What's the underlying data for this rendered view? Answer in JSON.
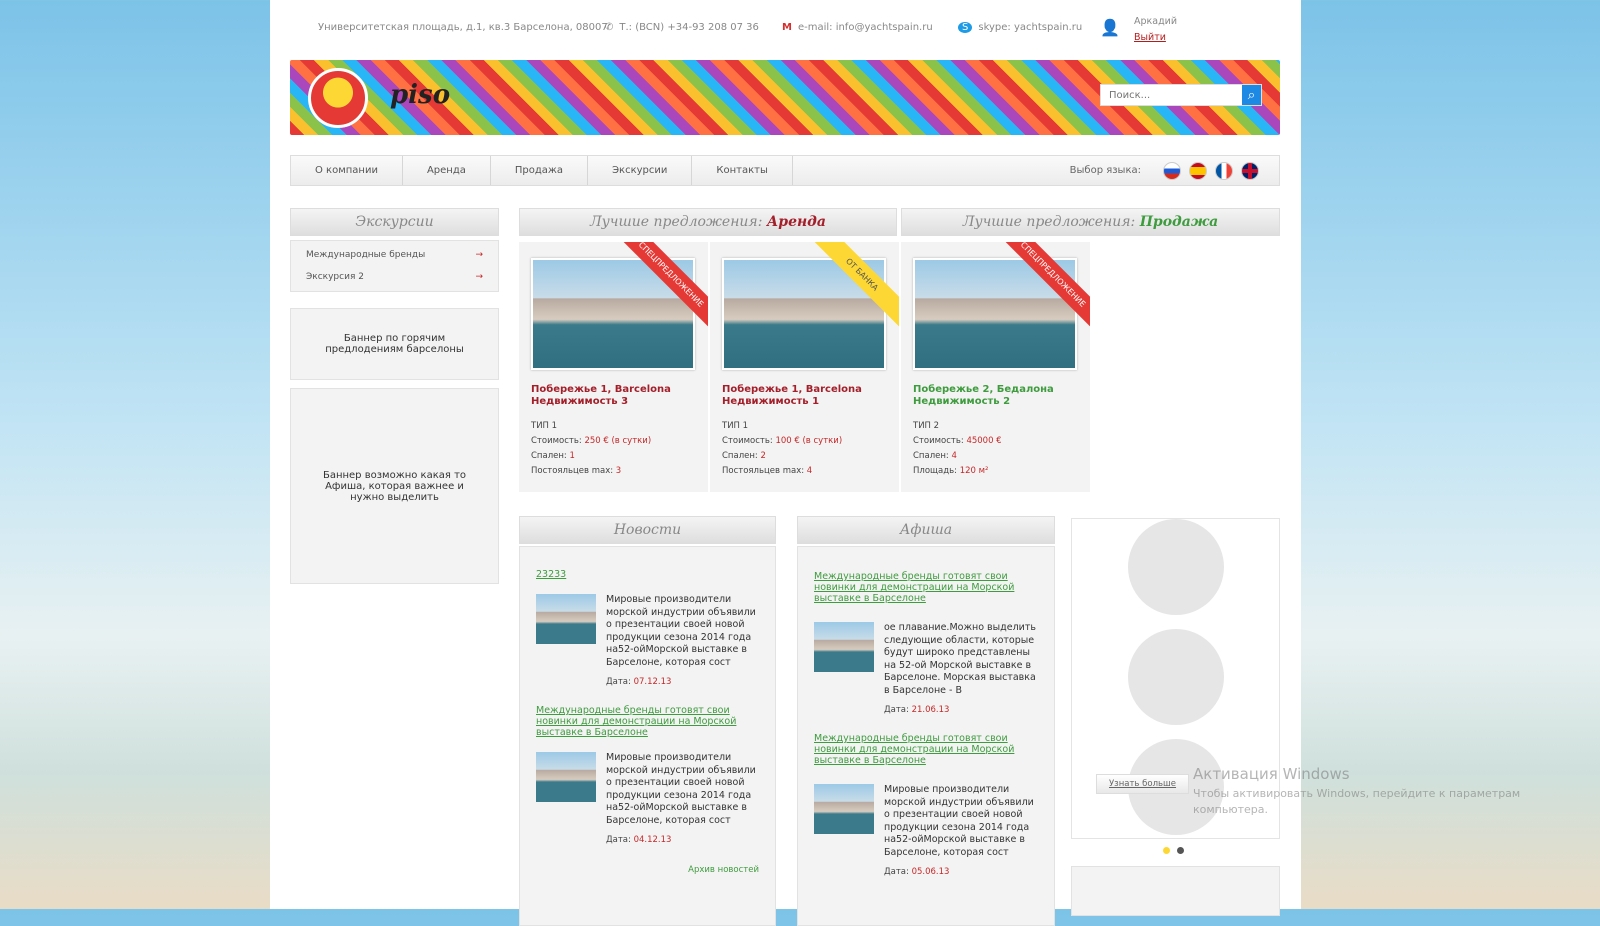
{
  "topbar": {
    "address": "Университетская площадь, д.1, кв.3 Барселона, 08007",
    "phone": "Т.: (BCN) +34-93 208 07 36",
    "email": "e-mail: info@yachtspain.ru",
    "skype": "skype: yachtspain.ru",
    "user": "Аркадий",
    "logout": "Выйти"
  },
  "logo": {
    "text": "piso"
  },
  "search": {
    "placeholder": "Поиск..."
  },
  "nav": {
    "items": [
      "О компании",
      "Аренда",
      "Продажа",
      "Экскурсии",
      "Контакты"
    ],
    "lang_label": "Выбор языка:"
  },
  "sidebar": {
    "title": "Экскурсии",
    "items": [
      "Международные бренды",
      "Экскурсия 2"
    ],
    "banner1": "Баннер по горячим предлодениям барселоны",
    "banner2": "Баннер возможно какая то Афиша, которая важнее и нужно выделить"
  },
  "offers": {
    "rent_prefix": "Лучшие предложения: ",
    "rent": "Аренда",
    "sale_prefix": "Лучшие предложения: ",
    "sale": "Продажа",
    "cards": [
      {
        "ribbon": "СПЕЦПРЕДЛОЖЕНИЕ",
        "line1": "Побережье 1, Barcelona",
        "line2": "Недвижимость 3",
        "type": "ТИП 1",
        "l1": "Стоимость: ",
        "v1": "250 € (в сутки)",
        "l2": "Спален: ",
        "v2": "1",
        "l3": "Постояльцев max: ",
        "v3": "3"
      },
      {
        "ribbon": "ОТ БАНКА",
        "line1": "Побережье 1, Barcelona",
        "line2": "Недвижимость 1",
        "type": "ТИП 1",
        "l1": "Стоимость: ",
        "v1": "100 € (в сутки)",
        "l2": "Спален: ",
        "v2": "2",
        "l3": "Постояльцев max: ",
        "v3": "4"
      },
      {
        "ribbon": "СПЕЦПРЕДЛОЖЕНИЕ",
        "line1": "Побережье 2, Бедалона",
        "line2": "Недвижимость 2",
        "type": "ТИП 2",
        "l1": "Стоимость: ",
        "v1": "45000 €",
        "l2": "Спален: ",
        "v2": "4",
        "l3": "Площадь: ",
        "v3": "120 м²"
      }
    ]
  },
  "news": {
    "title": "Новости",
    "first_link": "23233",
    "items": [
      {
        "text": "Мировые производители морской индустрии объявили о презентации своей новой продукции сезона 2014 года на52-ойМорской выставке в Барселоне, которая сост",
        "date_label": "Дата: ",
        "date": "07.12.13"
      },
      {
        "link": "Международные бренды готовят свои новинки для демонстрации на Морской выставке в Барселоне",
        "text": "Мировые производители морской индустрии объявили о презентации своей новой продукции сезона 2014 года на52-ойМорской выставке в Барселоне, которая сост",
        "date_label": "Дата: ",
        "date": "04.12.13"
      }
    ],
    "archive": "Архив новостей"
  },
  "afisha": {
    "title": "Афиша",
    "items": [
      {
        "link": "Международные бренды готовят свои новинки для демонстрации на Морской выставке в Барселоне",
        "text": "ое плавание.Можно выделить следующие области, которые будут широко представлены на 52-ой Морской выставке в Барселоне. Морская выставка в Барселоне - В",
        "date_label": "Дата: ",
        "date": "21.06.13"
      },
      {
        "link": "Международные бренды готовят свои новинки для демонстрации на Морской выставке в Барселоне",
        "text": "Мировые производители морской индустрии объявили о презентации своей новой продукции сезона 2014 года на52-ойМорской выставке в Барселоне, которая сост",
        "date_label": "Дата: ",
        "date": "05.06.13"
      }
    ]
  },
  "slider": {
    "button": "Узнать больше"
  },
  "watermark": {
    "title": "Активация Windows",
    "text": "Чтобы активировать Windows, перейдите к параметрам компьютера."
  }
}
